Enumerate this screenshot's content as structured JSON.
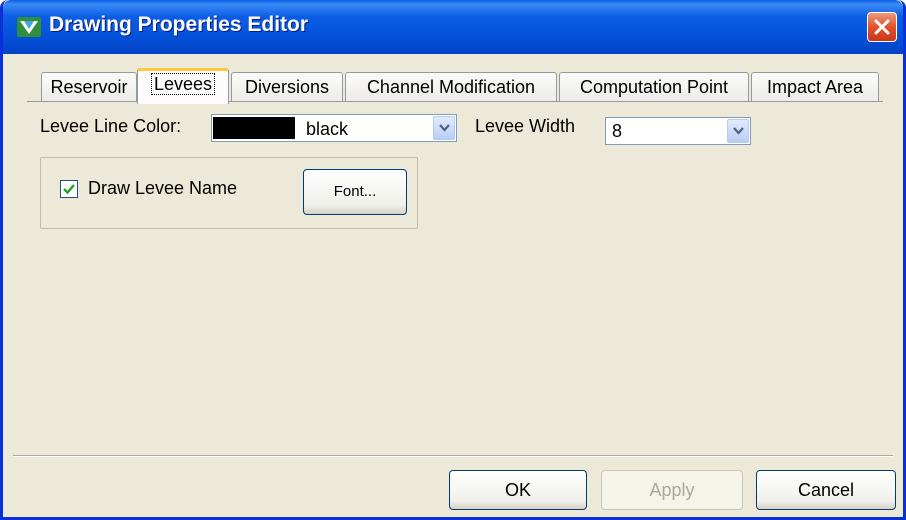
{
  "window": {
    "title": "Drawing Properties Editor"
  },
  "tabs": [
    {
      "label": "Reservoir"
    },
    {
      "label": "Levees"
    },
    {
      "label": "Diversions"
    },
    {
      "label": "Channel Modification"
    },
    {
      "label": "Computation Point"
    },
    {
      "label": "Impact Area"
    }
  ],
  "active_tab": "Levees",
  "levee_tab": {
    "line_color_label": "Levee Line Color:",
    "line_color_value": "black",
    "line_color_swatch": "#000000",
    "width_label": "Levee Width",
    "width_value": "8",
    "draw_name_label": "Draw Levee Name",
    "draw_name_checked": true,
    "font_button_label": "Font..."
  },
  "footer": {
    "ok_label": "OK",
    "apply_label": "Apply",
    "apply_enabled": false,
    "cancel_label": "Cancel"
  },
  "colors": {
    "titlebar": "#0451d8",
    "dialog_bg": "#ece9d8",
    "active_tab_accent": "#ffc83c",
    "close_button": "#e2512c"
  }
}
